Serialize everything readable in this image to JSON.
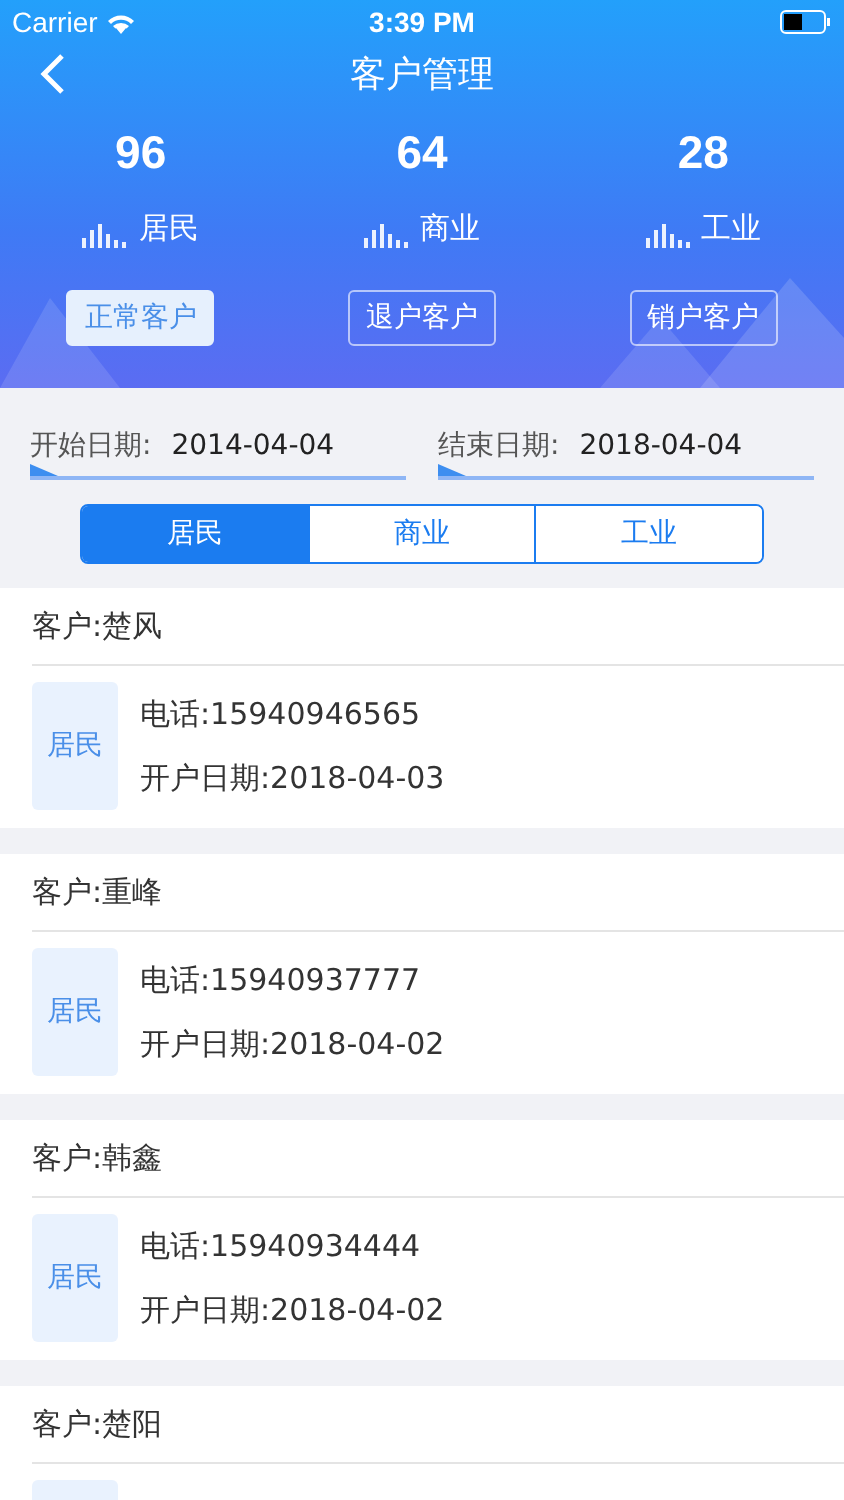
{
  "status_bar": {
    "carrier": "Carrier",
    "time": "3:39 PM"
  },
  "nav": {
    "title": "客户管理"
  },
  "stats": [
    {
      "value": "96",
      "label": "居民"
    },
    {
      "value": "64",
      "label": "商业"
    },
    {
      "value": "28",
      "label": "工业"
    }
  ],
  "status_tabs": [
    {
      "label": "正常客户",
      "selected": true
    },
    {
      "label": "退户客户",
      "selected": false
    },
    {
      "label": "销户客户",
      "selected": false
    }
  ],
  "date_filters": [
    {
      "label": "开始日期:",
      "value": "2014-04-04"
    },
    {
      "label": "结束日期:",
      "value": "2018-04-04"
    }
  ],
  "type_tabs": [
    {
      "label": "居民",
      "selected": true
    },
    {
      "label": "商业",
      "selected": false
    },
    {
      "label": "工业",
      "selected": false
    }
  ],
  "customers": [
    {
      "name": "客户:楚风",
      "tag": "居民",
      "phone": "电话:15940946565",
      "opened": "开户日期:2018-04-03"
    },
    {
      "name": "客户:重峰",
      "tag": "居民",
      "phone": "电话:15940937777",
      "opened": "开户日期:2018-04-02"
    },
    {
      "name": "客户:韩鑫",
      "tag": "居民",
      "phone": "电话:15940934444",
      "opened": "开户日期:2018-04-02"
    },
    {
      "name": "客户:楚阳"
    }
  ]
}
